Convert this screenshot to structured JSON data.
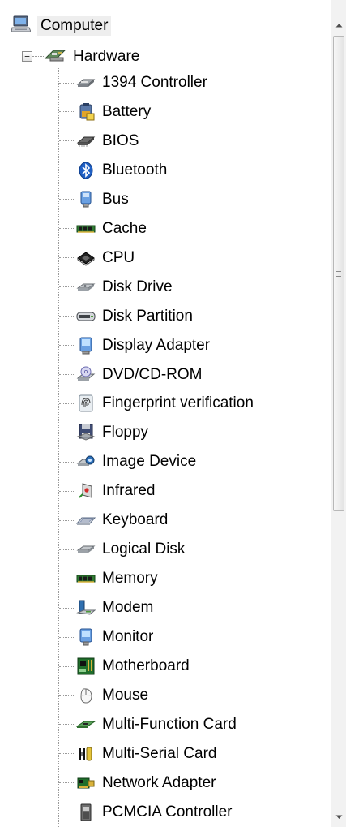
{
  "tree": {
    "root": {
      "label": "Computer",
      "icon": "computer-icon"
    },
    "category": {
      "label": "Hardware",
      "icon": "hardware-icon",
      "expanded": true,
      "expander_glyph": "−"
    },
    "items": [
      {
        "label": "1394 Controller",
        "icon": "controller-card-icon"
      },
      {
        "label": "Battery",
        "icon": "battery-icon"
      },
      {
        "label": "BIOS",
        "icon": "chip-icon"
      },
      {
        "label": "Bluetooth",
        "icon": "bluetooth-icon"
      },
      {
        "label": "Bus",
        "icon": "bus-icon"
      },
      {
        "label": "Cache",
        "icon": "memory-module-icon"
      },
      {
        "label": "CPU",
        "icon": "cpu-icon"
      },
      {
        "label": "Disk Drive",
        "icon": "disk-drive-icon"
      },
      {
        "label": "Disk Partition",
        "icon": "partition-icon"
      },
      {
        "label": "Display Adapter",
        "icon": "display-adapter-icon"
      },
      {
        "label": "DVD/CD-ROM",
        "icon": "optical-drive-icon"
      },
      {
        "label": "Fingerprint verification",
        "icon": "fingerprint-icon"
      },
      {
        "label": "Floppy",
        "icon": "floppy-icon"
      },
      {
        "label": "Image Device",
        "icon": "camera-icon"
      },
      {
        "label": "Infrared",
        "icon": "infrared-icon"
      },
      {
        "label": "Keyboard",
        "icon": "keyboard-icon"
      },
      {
        "label": "Logical Disk",
        "icon": "logical-disk-icon"
      },
      {
        "label": "Memory",
        "icon": "memory-module-icon"
      },
      {
        "label": "Modem",
        "icon": "modem-icon"
      },
      {
        "label": "Monitor",
        "icon": "monitor-icon"
      },
      {
        "label": "Motherboard",
        "icon": "motherboard-icon"
      },
      {
        "label": "Mouse",
        "icon": "mouse-icon"
      },
      {
        "label": "Multi-Function Card",
        "icon": "card-icon"
      },
      {
        "label": "Multi-Serial Card",
        "icon": "serial-card-icon"
      },
      {
        "label": "Network Adapter",
        "icon": "network-adapter-icon"
      },
      {
        "label": "PCMCIA Controller",
        "icon": "pcmcia-icon"
      }
    ]
  },
  "scrollbar": {
    "up_icon": "scroll-up-arrow-icon",
    "down_icon": "scroll-down-arrow-icon",
    "thumb_icon": "scroll-grip-icon"
  },
  "colors": {
    "selection_bg": "#eeeeee",
    "tree_line": "#9a9a9a",
    "scrollbar_track": "#f2f2f2"
  }
}
